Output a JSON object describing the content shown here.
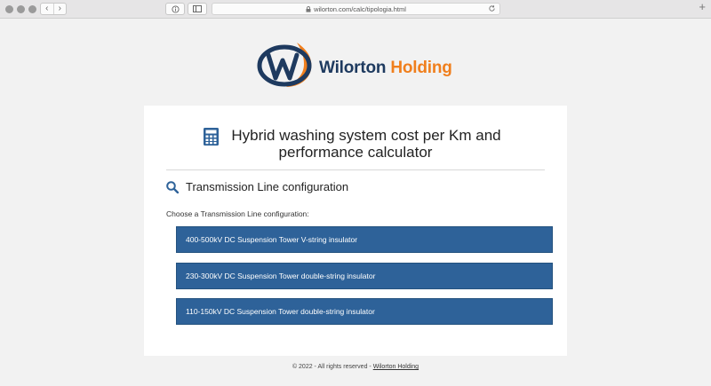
{
  "browser": {
    "url": "wilorton.com/calc/tipologia.html",
    "back_label": "‹",
    "forward_label": "›"
  },
  "logo": {
    "name_main": "Wilorton",
    "name_accent": "Holding"
  },
  "card": {
    "title_line1": "Hybrid washing system cost per Km and",
    "title_line2": "performance calculator",
    "section_title": "Transmission Line configuration",
    "prompt": "Choose a Transmission Line configuration:",
    "options": [
      {
        "label": "400-500kV DC Suspension Tower V-string insulator"
      },
      {
        "label": "230-300kV DC Suspension Tower double-string insulator"
      },
      {
        "label": "110-150kV DC Suspension Tower double-string insulator"
      }
    ]
  },
  "footer": {
    "text": "© 2022 - All rights reserved - ",
    "link": "Wilorton Holding"
  },
  "colors": {
    "brand_blue": "#1e3a5f",
    "brand_orange": "#f07f1d",
    "button_blue": "#2e6299"
  }
}
